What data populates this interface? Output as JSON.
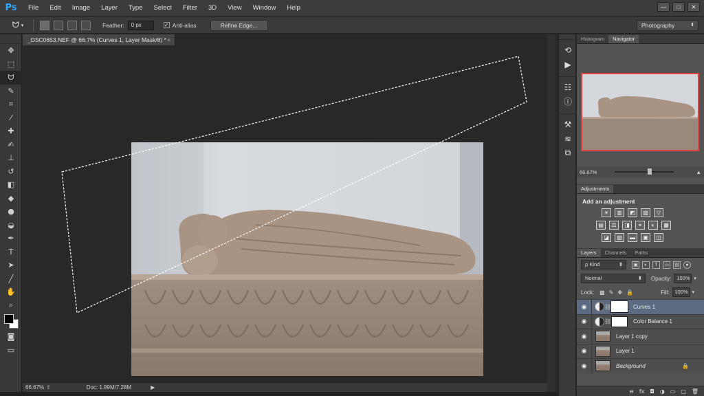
{
  "app": {
    "logo": "Ps"
  },
  "menu": [
    "File",
    "Edit",
    "Image",
    "Layer",
    "Type",
    "Select",
    "Filter",
    "3D",
    "View",
    "Window",
    "Help"
  ],
  "window_controls": [
    "—",
    "□",
    "✕"
  ],
  "options": {
    "feather_label": "Feather:",
    "feather_value": "0 px",
    "antialias_label": "Anti-alias",
    "refine_label": "Refine Edge...",
    "workspace": "Photography"
  },
  "document": {
    "tab_title": "_DSC0653.NEF @ 66.7% (Curves 1, Layer Mask/8) *",
    "close": "×",
    "status_zoom": "66.67%",
    "status_doc": "Doc: 1.99M/7.28M",
    "status_arrow": "▶"
  },
  "tools": [
    {
      "name": "move-tool-icon",
      "glyph": "✥"
    },
    {
      "name": "marquee-tool-icon",
      "glyph": "⬚"
    },
    {
      "name": "lasso-tool-icon",
      "glyph": "ᗢ",
      "active": true
    },
    {
      "name": "quick-select-tool-icon",
      "glyph": "✎"
    },
    {
      "name": "crop-tool-icon",
      "glyph": "⌗"
    },
    {
      "name": "eyedropper-tool-icon",
      "glyph": "⁄"
    },
    {
      "name": "healing-tool-icon",
      "glyph": "✚"
    },
    {
      "name": "brush-tool-icon",
      "glyph": "✍"
    },
    {
      "name": "stamp-tool-icon",
      "glyph": "⊥"
    },
    {
      "name": "history-brush-tool-icon",
      "glyph": "↺"
    },
    {
      "name": "eraser-tool-icon",
      "glyph": "◧"
    },
    {
      "name": "paint-bucket-tool-icon",
      "glyph": "◆"
    },
    {
      "name": "blur-tool-icon",
      "glyph": "●"
    },
    {
      "name": "dodge-tool-icon",
      "glyph": "◒"
    },
    {
      "name": "pen-tool-icon",
      "glyph": "✒"
    },
    {
      "name": "type-tool-icon",
      "glyph": "T"
    },
    {
      "name": "path-select-tool-icon",
      "glyph": "➤"
    },
    {
      "name": "line-tool-icon",
      "glyph": "╱"
    },
    {
      "name": "hand-tool-icon",
      "glyph": "✋"
    },
    {
      "name": "zoom-tool-icon",
      "glyph": "⌕"
    }
  ],
  "dock_icons": [
    {
      "name": "history-icon",
      "glyph": "⟲"
    },
    {
      "name": "play-icon",
      "glyph": "▶"
    },
    {
      "name": "properties-icon",
      "glyph": "☷"
    },
    {
      "name": "info-icon",
      "glyph": "ⓘ"
    },
    {
      "name": "tool-presets-icon",
      "glyph": "⚒"
    },
    {
      "name": "brush-presets-icon",
      "glyph": "≋"
    },
    {
      "name": "clone-source-icon",
      "glyph": "⧉"
    }
  ],
  "navigator": {
    "tabs": [
      "Histogram",
      "Navigator"
    ],
    "zoom": "66.67%"
  },
  "adjustments": {
    "tab": "Adjustments",
    "title": "Add an adjustment",
    "row1": [
      "☀",
      "▥",
      "◩",
      "▨",
      "▽"
    ],
    "row2": [
      "▤",
      "⚖",
      "◨",
      "⚭",
      "◐",
      "▦"
    ],
    "row3": [
      "◪",
      "▧",
      "▬",
      "▣",
      "◫"
    ]
  },
  "layers": {
    "tabs": [
      "Layers",
      "Channels",
      "Paths"
    ],
    "kind": "ρ Kind",
    "blend_mode": "Normal",
    "opacity_label": "Opacity:",
    "opacity_value": "100%",
    "lock_label": "Lock:",
    "fill_label": "Fill:",
    "fill_value": "100%",
    "items": [
      {
        "name": "Curves 1",
        "type": "adjustment"
      },
      {
        "name": "Color Balance 1",
        "type": "adjustment"
      },
      {
        "name": "Layer 1 copy",
        "type": "image"
      },
      {
        "name": "Layer 1",
        "type": "image"
      },
      {
        "name": "Background",
        "type": "image"
      }
    ],
    "footer": [
      "⊖",
      "fx",
      "◘",
      "◑",
      "▭",
      "▢",
      "🗑"
    ]
  }
}
